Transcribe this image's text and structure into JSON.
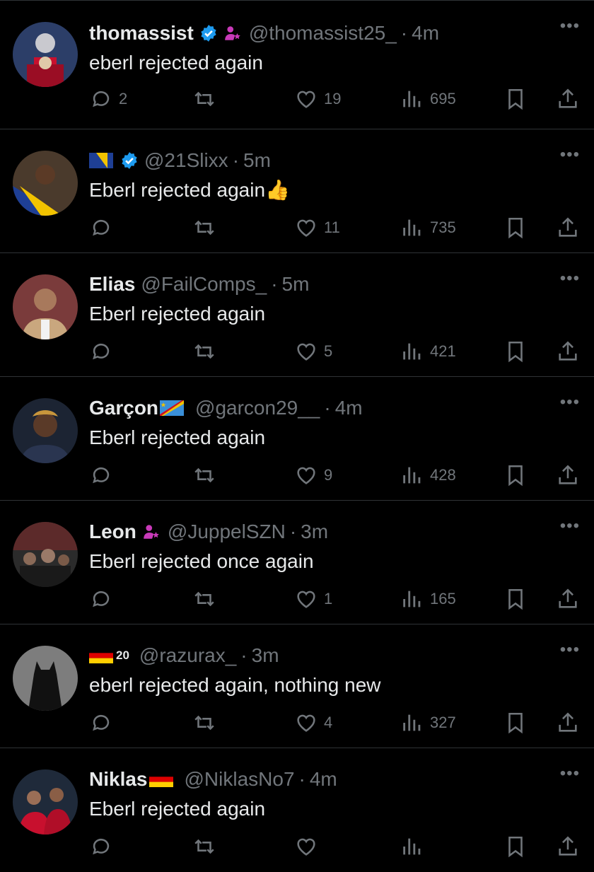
{
  "tweets": [
    {
      "name": "thomassist",
      "handle": "@thomassist25_",
      "time": "4m",
      "text": "eberl rejected again",
      "replies": "2",
      "retweets": "",
      "likes": "19",
      "views": "695",
      "verified": true,
      "spark": true
    },
    {
      "name": "",
      "handle": "@21Slixx",
      "time": "5m",
      "text": "Eberl rejected again👍",
      "replies": "",
      "retweets": "",
      "likes": "11",
      "views": "735",
      "verified": true,
      "flag": "bosnia"
    },
    {
      "name": "Elias",
      "handle": "@FailComps_",
      "time": "5m",
      "text": "Eberl rejected again",
      "replies": "",
      "retweets": "",
      "likes": "5",
      "views": "421"
    },
    {
      "name": "Garçon",
      "handle": "@garcon29__",
      "time": "4m",
      "text": "Eberl rejected again",
      "replies": "",
      "retweets": "",
      "likes": "9",
      "views": "428",
      "flag": "drc"
    },
    {
      "name": "Leon",
      "handle": "@JuppelSZN",
      "time": "3m",
      "text": "Eberl rejected once again",
      "replies": "",
      "retweets": "",
      "likes": "1",
      "views": "165",
      "spark": true
    },
    {
      "name": "",
      "sup": "20",
      "handle": "@razurax_",
      "time": "3m",
      "text": "eberl rejected again, nothing new",
      "replies": "",
      "retweets": "",
      "likes": "4",
      "views": "327",
      "flag": "germany"
    },
    {
      "name": "Niklas",
      "handle": "@NiklasNo7",
      "time": "4m",
      "text": "Eberl rejected again",
      "replies": "",
      "retweets": "",
      "likes": "",
      "views": "",
      "flag": "germany"
    }
  ],
  "more_label": "•••",
  "dot": "·",
  "colors": {
    "muted": "#71767b",
    "verified": "#1d9bf0",
    "spark": "#c93ab9"
  }
}
